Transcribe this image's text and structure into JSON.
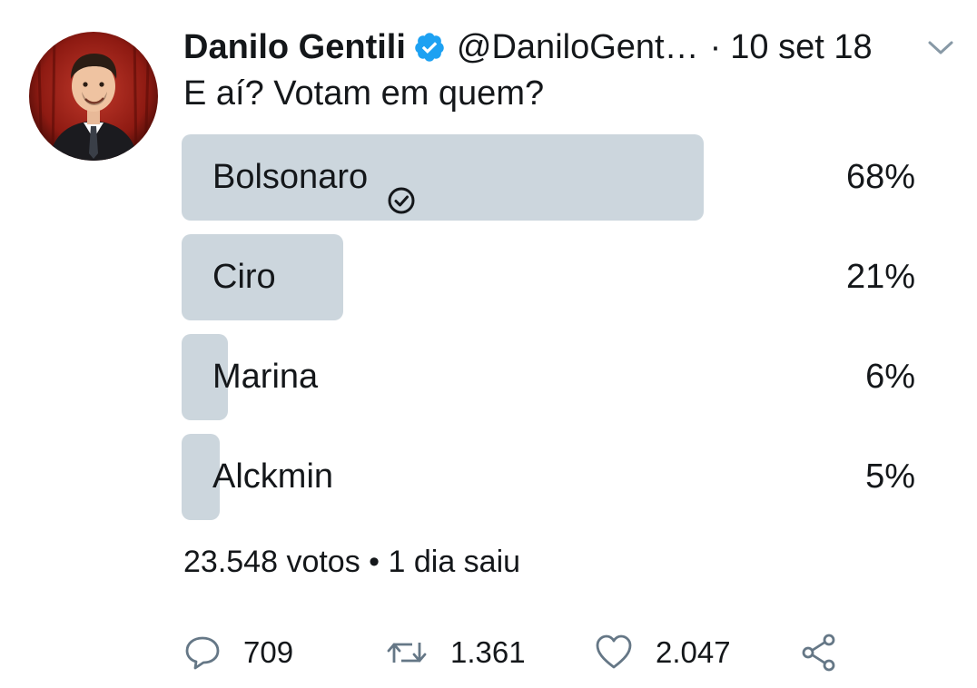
{
  "tweet": {
    "author_name": "Danilo Gentili",
    "handle": "@DaniloGent…",
    "separator": "·",
    "date": "10 set 18",
    "text": "E aí? Votam em quem?",
    "colors": {
      "verified": "#1da1f2",
      "poll_bar": "#ccd6dd",
      "text": "#14171a",
      "icon": "#657786"
    }
  },
  "poll": {
    "options": [
      {
        "label": "Bolsonaro",
        "percent_text": "68%",
        "fraction": 0.68,
        "winner": true
      },
      {
        "label": "Ciro",
        "percent_text": "21%",
        "fraction": 0.21,
        "winner": false
      },
      {
        "label": "Marina",
        "percent_text": "6%",
        "fraction": 0.06,
        "winner": false
      },
      {
        "label": "Alckmin",
        "percent_text": "5%",
        "fraction": 0.05,
        "winner": false
      }
    ],
    "meta": "23.548 votos • 1 dia saiu"
  },
  "actions": {
    "reply_count": "709",
    "retweet_count": "1.361",
    "like_count": "2.047"
  },
  "icons": {
    "reply": "reply-icon",
    "retweet": "retweet-icon",
    "like": "heart-icon",
    "share": "share-icon",
    "verified": "verified-badge-icon",
    "check": "check-circle-icon",
    "caret": "chevron-down-icon"
  }
}
